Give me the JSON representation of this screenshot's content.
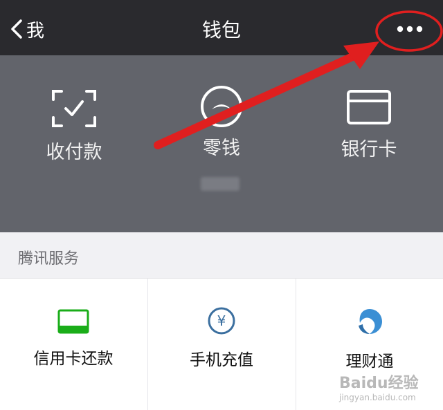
{
  "nav": {
    "back_label": "我",
    "title": "钱包",
    "more_icon": "more-dots-icon"
  },
  "wallet": {
    "items": [
      {
        "label": "收付款",
        "icon": "scan-pay-icon"
      },
      {
        "label": "零钱",
        "icon": "coin-icon"
      },
      {
        "label": "银行卡",
        "icon": "bank-card-icon"
      }
    ]
  },
  "tencent_services": {
    "header": "腾讯服务",
    "items": [
      {
        "label": "信用卡还款",
        "icon": "credit-card-repay-icon"
      },
      {
        "label": "手机充值",
        "icon": "yuan-icon"
      },
      {
        "label": "理财通",
        "icon": "wealth-icon"
      }
    ]
  },
  "colors": {
    "nav_bg": "#2a2a2e",
    "top_band_bg": "#62646b",
    "accent_green": "#1aad19",
    "yuan_blue": "#3b6f9f",
    "annotation_red": "#e01f1f"
  },
  "watermark": {
    "brand": "Baidu经验",
    "url": "jingyan.baidu.com"
  }
}
